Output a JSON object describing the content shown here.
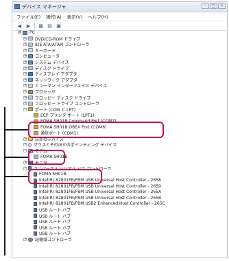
{
  "window": {
    "title": "デバイス マネージャ",
    "controls": [
      "–",
      "□",
      "×"
    ]
  },
  "menu": [
    "ファイル(E)",
    "操作(A)",
    "表示(V)",
    "ヘルプ(H)"
  ],
  "toolbar": [
    "arrow-left-icon",
    "arrow-right-icon",
    "properties-icon",
    "update-icon",
    "scan-icon"
  ],
  "tree": [
    {
      "label": "PC",
      "level": 0,
      "icon": "computer-icon",
      "expander": "⊟"
    },
    {
      "label": "DVD/CD-ROM ドライブ",
      "level": 1,
      "icon": "dvd-drive-icon",
      "expander": "+"
    },
    {
      "label": "IDE ATA/ATAPI コントローラ",
      "level": 1,
      "icon": "ide-controller-icon",
      "expander": "+"
    },
    {
      "label": "キーボード",
      "level": 1,
      "icon": "keyboard-icon",
      "expander": "+"
    },
    {
      "label": "コンピュータ",
      "level": 1,
      "icon": "computer-icon",
      "expander": "+"
    },
    {
      "label": "システム デバイス",
      "level": 1,
      "icon": "system-device-icon",
      "expander": "+"
    },
    {
      "label": "ディスク ドライブ",
      "level": 1,
      "icon": "disk-drive-icon",
      "expander": "+"
    },
    {
      "label": "ディスプレイ アダプタ",
      "level": 1,
      "icon": "display-adapter-icon",
      "expander": "+"
    },
    {
      "label": "ネットワーク アダプタ",
      "level": 1,
      "icon": "network-adapter-icon",
      "expander": "+"
    },
    {
      "label": "ヒューマン インターフェイス デバイス",
      "level": 1,
      "icon": "hid-icon",
      "expander": "+"
    },
    {
      "label": "プロセッサ",
      "level": 1,
      "icon": "processor-icon",
      "expander": "+"
    },
    {
      "label": "フロッピー ディスク ドライブ",
      "level": 1,
      "icon": "floppy-drive-icon",
      "expander": "+"
    },
    {
      "label": "フロッピー ドライブ コントローラ",
      "level": 1,
      "icon": "floppy-controller-icon",
      "expander": "+"
    },
    {
      "label": "ポート (COM と LPT)",
      "level": 1,
      "icon": "port-icon",
      "expander": "−"
    },
    {
      "label": "ECP プリンタ ポート (LPT1)",
      "level": 2,
      "icon": "port-icon"
    },
    {
      "label": "FOMA SH01B Command Port (COM7)",
      "level": 2,
      "icon": "port-icon"
    },
    {
      "label": "FOMA SH01B OBEX Port (COM6)",
      "level": 2,
      "icon": "port-icon"
    },
    {
      "label": "通信ポート (COM1)",
      "level": 2,
      "icon": "port-icon"
    },
    {
      "label": "ほかのデバイス",
      "level": 1,
      "icon": "other-device-icon",
      "expander": "+"
    },
    {
      "label": "マウスとそのほかのポインティング デバイス",
      "level": 1,
      "icon": "mouse-icon",
      "expander": "+"
    },
    {
      "label": "モデム",
      "level": 1,
      "icon": "modem-icon",
      "expander": "−"
    },
    {
      "label": "FOMA SH01B",
      "level": 2,
      "icon": "modem-icon"
    },
    {
      "label": "モニタ",
      "level": 1,
      "icon": "monitor-icon",
      "expander": "+"
    },
    {
      "label": "ユニバーサル シリアル バス コントローラ",
      "level": 1,
      "icon": "usb-icon",
      "expander": "−"
    },
    {
      "label": "FOMA SH01B",
      "level": 2,
      "icon": "usb-icon"
    },
    {
      "label": "Intel(R) 82801FB/FBM USB Universal Host Controller - 2658",
      "level": 2,
      "icon": "usb-icon"
    },
    {
      "label": "Intel(R) 82801FB/FBM USB Universal Host Controller - 2659",
      "level": 2,
      "icon": "usb-icon"
    },
    {
      "label": "Intel(R) 82801FB/FBM USB Universal Host Controller - 265A",
      "level": 2,
      "icon": "usb-icon"
    },
    {
      "label": "Intel(R) 82801FB/FBM USB Universal Host Controller - 265B",
      "level": 2,
      "icon": "usb-icon"
    },
    {
      "label": "Intel(R) 82801FB/FBM USB2 Enhanced Host Controller - 265C",
      "level": 2,
      "icon": "usb-icon"
    },
    {
      "label": "USB ルート ハブ",
      "level": 2,
      "icon": "usb-icon"
    },
    {
      "label": "USB ルート ハブ",
      "level": 2,
      "icon": "usb-icon"
    },
    {
      "label": "USB ルート ハブ",
      "level": 2,
      "icon": "usb-icon"
    },
    {
      "label": "USB ルート ハブ",
      "level": 2,
      "icon": "usb-icon"
    },
    {
      "label": "USB ルート ハブ",
      "level": 2,
      "icon": "usb-icon"
    },
    {
      "label": "記憶域コントローラ",
      "level": 1,
      "icon": "storage-controller-icon",
      "expander": "+"
    }
  ],
  "colors": {
    "highlight": "#c01058",
    "callout": "#1a1a1a"
  }
}
